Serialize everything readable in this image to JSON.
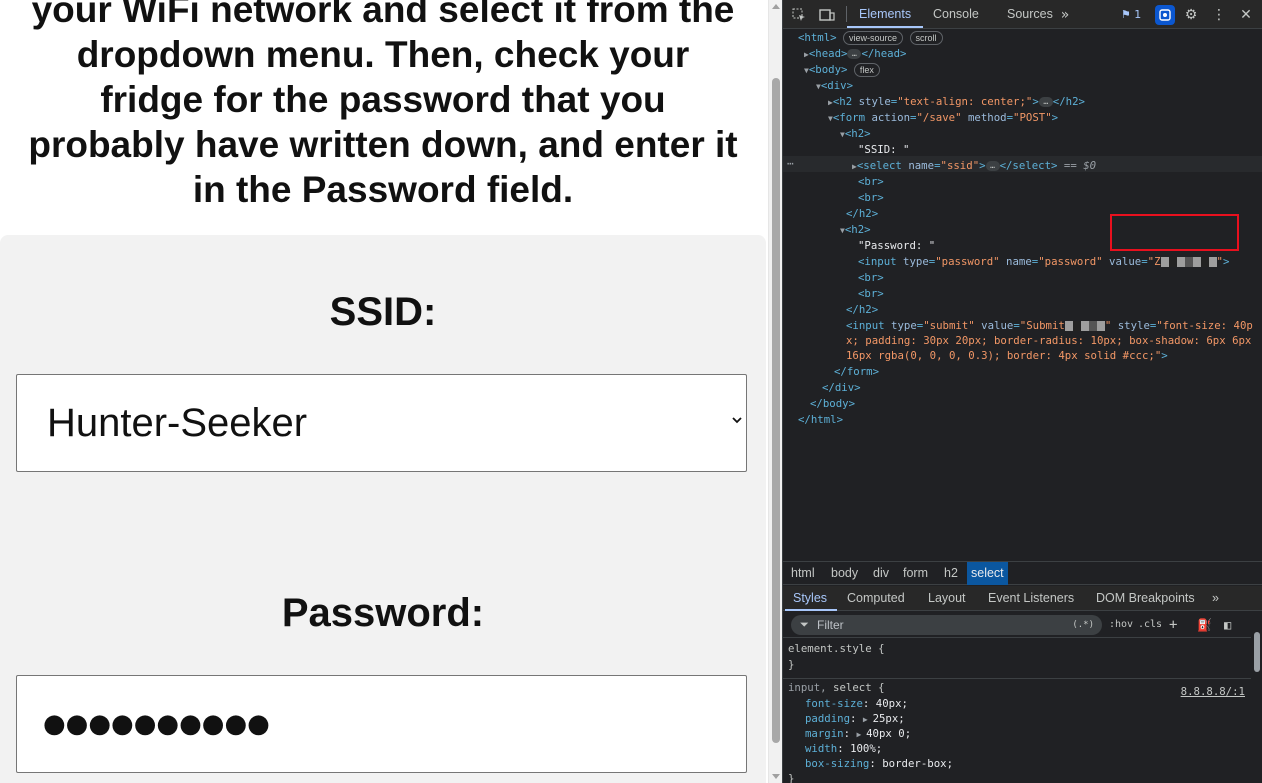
{
  "page": {
    "heading_lines": [
      "your WiFi network and select it from the",
      "dropdown menu. Then, check your",
      "fridge for the password that you",
      "probably have written down, and enter it",
      "in the Password field."
    ],
    "ssid_label": "SSID:",
    "ssid_selected": "Hunter-Seeker",
    "password_label": "Password:",
    "password_mask": "●●●●●●●●●●"
  },
  "devtools": {
    "tabs": [
      "Elements",
      "Console",
      "Sources"
    ],
    "issues_count": "1",
    "dom": {
      "html_badges": [
        "view-source",
        "scroll"
      ],
      "body_badge": "flex",
      "selected_suffix": "== $0",
      "h2_style": "text-align: center;",
      "form_action": "/save",
      "form_method": "POST",
      "ssid_text": "\"SSID: \"",
      "select_name": "ssid",
      "password_text": "\"Password: \"",
      "input_type": "password",
      "input_name": "password",
      "input_value_prefix": "Z",
      "submit_type": "submit",
      "submit_value_prefix": "Submit",
      "submit_style_1": "font-size: 40p",
      "submit_style_2": "x; padding: 30px 20px; border-radius: 10px; box-shadow: 6px 6px",
      "submit_style_3": "16px rgba(0, 0, 0, 0.3); border: 4px solid #ccc;"
    },
    "breadcrumbs": [
      "html",
      "body",
      "div",
      "form",
      "h2",
      "select"
    ],
    "styles_tabs": [
      "Styles",
      "Computed",
      "Layout",
      "Event Listeners",
      "DOM Breakpoints"
    ],
    "filter_placeholder": "Filter",
    "filter_tools": [
      ":hov",
      ".cls"
    ],
    "styles": {
      "element_style": "element.style {",
      "rule_selector_dim": "input,",
      "rule_selector": "select {",
      "rule_source": "8.8.8.8/:1",
      "props": [
        {
          "name": "font-size",
          "value": "40px;"
        },
        {
          "name": "padding",
          "value": "25px;"
        },
        {
          "name": "margin",
          "value": "40px 0;"
        },
        {
          "name": "width",
          "value": "100%;"
        },
        {
          "name": "box-sizing",
          "value": "border-box;"
        }
      ]
    }
  }
}
